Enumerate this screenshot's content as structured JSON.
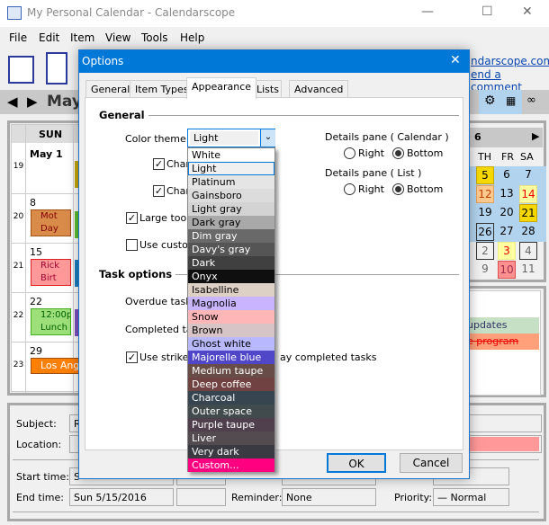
{
  "window": {
    "title": "My Personal Calendar - Calendarscope",
    "minimize": "—",
    "maximize": "☐",
    "close": "✕"
  },
  "menu": [
    "File",
    "Edit",
    "Item",
    "View",
    "Tools",
    "Help"
  ],
  "toolbar": {
    "link1": "ndarscope.com",
    "link2": "end a comment"
  },
  "nav": {
    "month": "May"
  },
  "calendar": {
    "day_header": "SUN",
    "weeks": [
      "19",
      "20",
      "21",
      "22",
      "23"
    ],
    "days": [
      "May 1",
      "8",
      "15",
      "22",
      "29"
    ],
    "events": [
      {
        "text1": "Mot",
        "text2": "Day",
        "color": "#d98b4a"
      },
      {
        "text1": "Rick",
        "text2": "Birt",
        "color": "#ff9999"
      },
      {
        "text1": "12:00pi",
        "text2": "Lunch",
        "color": "#9de07a"
      },
      {
        "text1": "Los Ange",
        "text2": "",
        "color": "#ff7f00"
      }
    ]
  },
  "mini": {
    "header": "6",
    "days": [
      "TH",
      "FR",
      "SA"
    ],
    "rows": [
      [
        "5",
        "6",
        "7"
      ],
      [
        "12",
        "13",
        "14"
      ],
      [
        "19",
        "20",
        "21"
      ],
      [
        "26",
        "27",
        "28"
      ],
      [
        "2",
        "3",
        "4"
      ],
      [
        "9",
        "10",
        "11"
      ]
    ]
  },
  "tasks": [
    {
      "text": "updates",
      "color": "#c6e0c6"
    },
    {
      "text": "e program",
      "color": "#ffa07a"
    }
  ],
  "details": {
    "subject_label": "Subject:",
    "subject_value": "Ri",
    "location_label": "Location:",
    "start_label": "Start time:",
    "start_value": "S",
    "end_label": "End time:",
    "end_value": "Sun 5/15/2016",
    "reminder_label": "Reminder:",
    "reminder_value": "None",
    "priority_label": "Priority:",
    "priority_value": "Normal"
  },
  "dialog": {
    "title": "Options",
    "tabs": [
      "General",
      "Item Types",
      "Appearance",
      "Lists",
      "Advanced"
    ],
    "active_tab": "Appearance",
    "general_heading": "General",
    "color_theme_label": "Color theme:",
    "color_theme_value": "Light",
    "cb1": "Chan",
    "cb2": "Chan",
    "cb3": "Large toolb",
    "cb4": "Use custom",
    "details_cal_label": "Details pane ( Calendar )",
    "details_list_label": "Details pane ( List )",
    "right": "Right",
    "bottom": "Bottom",
    "task_heading": "Task options",
    "overdue_label": "Overdue task c",
    "completed_label": "Completed task",
    "strike_label": "Use striketh",
    "strike_label_tail": "ay completed tasks",
    "ok": "OK",
    "cancel": "Cancel",
    "themes": [
      {
        "name": "White",
        "bg": "#ffffff",
        "fg": "#000"
      },
      {
        "name": "Light",
        "bg": "#f0f0f0",
        "fg": "#000"
      },
      {
        "name": "Platinum",
        "bg": "#e5e5e5",
        "fg": "#000"
      },
      {
        "name": "Gainsboro",
        "bg": "#dcdcdc",
        "fg": "#000"
      },
      {
        "name": "Light gray",
        "bg": "#d3d3d3",
        "fg": "#000"
      },
      {
        "name": "Dark gray",
        "bg": "#a9a9a9",
        "fg": "#000"
      },
      {
        "name": "Dim gray",
        "bg": "#696969",
        "fg": "#fff"
      },
      {
        "name": "Davy's gray",
        "bg": "#555555",
        "fg": "#fff"
      },
      {
        "name": "Dark",
        "bg": "#404040",
        "fg": "#fff"
      },
      {
        "name": "Onyx",
        "bg": "#0f0f0f",
        "fg": "#fff"
      },
      {
        "name": "Isabelline",
        "bg": "#ddd0c4",
        "fg": "#000"
      },
      {
        "name": "Magnolia",
        "bg": "#c8b4ff",
        "fg": "#000"
      },
      {
        "name": "Snow",
        "bg": "#ffb6b6",
        "fg": "#000"
      },
      {
        "name": "Brown",
        "bg": "#d7c4c6",
        "fg": "#000"
      },
      {
        "name": "Ghost white",
        "bg": "#b8b8ff",
        "fg": "#000"
      },
      {
        "name": "Majorelle blue",
        "bg": "#5046c8",
        "fg": "#fff"
      },
      {
        "name": "Medium taupe",
        "bg": "#674c47",
        "fg": "#fff"
      },
      {
        "name": "Deep coffee",
        "bg": "#704241",
        "fg": "#fff"
      },
      {
        "name": "Charcoal",
        "bg": "#36454f",
        "fg": "#fff"
      },
      {
        "name": "Outer space",
        "bg": "#414a4c",
        "fg": "#fff"
      },
      {
        "name": "Purple taupe",
        "bg": "#50404d",
        "fg": "#fff"
      },
      {
        "name": "Liver",
        "bg": "#534b4f",
        "fg": "#fff"
      },
      {
        "name": "Very dark",
        "bg": "#3a3a42",
        "fg": "#fff"
      },
      {
        "name": "Custom...",
        "bg": "#ff0080",
        "fg": "#fff"
      }
    ],
    "selected_theme": "Light"
  },
  "colors": {
    "accent": "#0078d7",
    "selection_highlight": "#b2d3ee"
  }
}
